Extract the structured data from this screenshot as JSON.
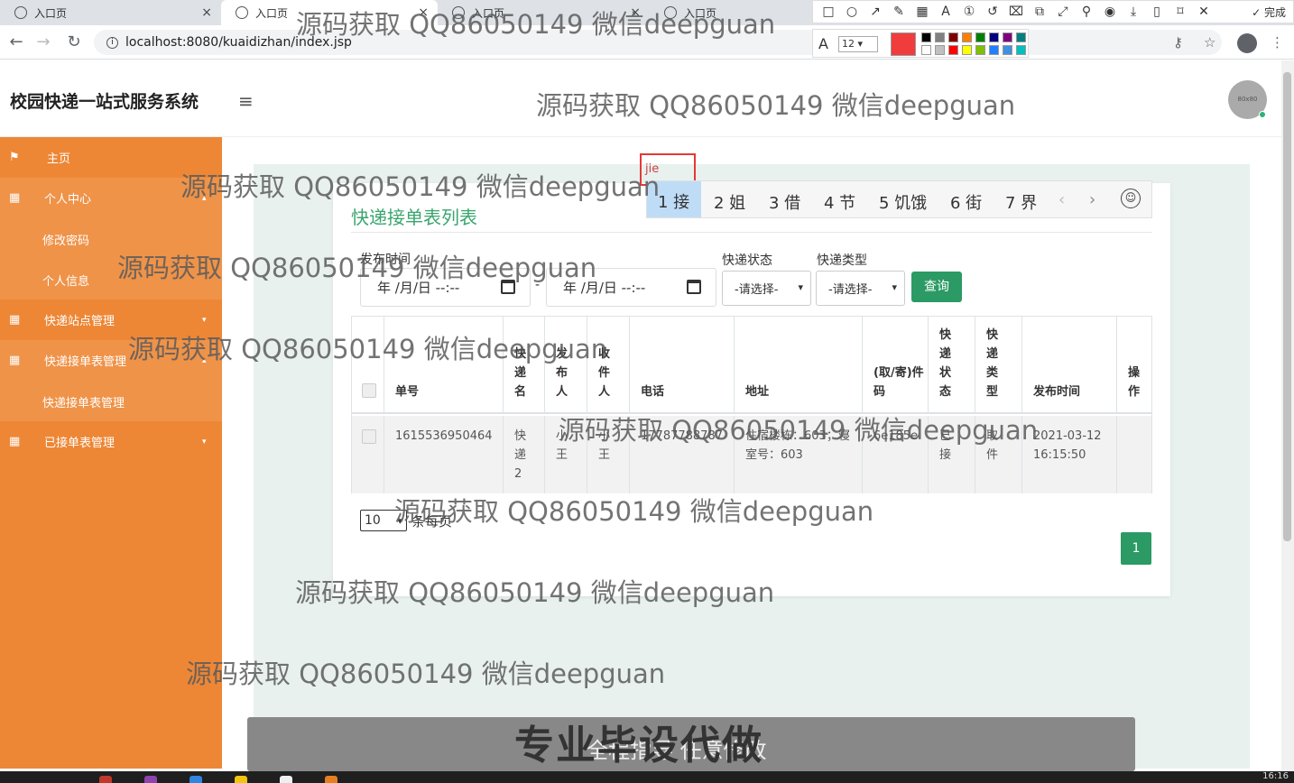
{
  "browser": {
    "tabs": [
      {
        "title": "入口页",
        "active": false
      },
      {
        "title": "入口页",
        "active": true
      },
      {
        "title": "入口页",
        "active": false
      },
      {
        "title": "入口页",
        "active": false
      }
    ],
    "url": "localhost:8080/kuaidizhan/index.jsp"
  },
  "annotation_toolbar": {
    "done_label": "完成",
    "font_size": "12",
    "current_color": "#f03c3c"
  },
  "app": {
    "title": "校园快递一站式服务系统",
    "avatar_text": "80x80"
  },
  "sidebar": {
    "items": [
      {
        "label": "主页"
      },
      {
        "label": "个人中心"
      },
      {
        "label": "修改密码"
      },
      {
        "label": "个人信息"
      },
      {
        "label": "快递站点管理"
      },
      {
        "label": "快递接单表管理"
      },
      {
        "label": "快递接单表管理"
      },
      {
        "label": "已接单表管理"
      }
    ]
  },
  "page": {
    "title": "快递接单表列表",
    "filters": {
      "publish_time_label": "发布时间",
      "date_placeholder": "年 /月/日  --:--",
      "status_label": "快递状态",
      "type_label": "快递类型",
      "select_placeholder": "-请选择-",
      "query_button": "查询"
    },
    "table": {
      "headers": [
        "单号",
        "快递名",
        "发布人",
        "收件人",
        "电话",
        "地址",
        "(取/寄)件码",
        "快递状态",
        "快递类型",
        "发布时间",
        "操作"
      ],
      "rows": [
        {
          "order_no": "1615536950464",
          "express_name": "快递2",
          "publisher": "小王",
          "receiver": "小王",
          "phone": "17787788787",
          "address": "住宿楼栋：603；寝室号：603",
          "code": "6e185e",
          "status": "已接",
          "type": "取件",
          "publish_time": "2021-03-12 16:15:50"
        }
      ]
    },
    "pagination": {
      "page_size": "10",
      "page_size_label": "条每页",
      "current_page": "1"
    }
  },
  "ime": {
    "input_text": "jie",
    "candidates": [
      "1 接",
      "2 姐",
      "3 借",
      "4 节",
      "5 饥饿",
      "6 街",
      "7 界"
    ]
  },
  "watermark": "源码获取 QQ86050149 微信deepguan",
  "banner": {
    "title": "专业毕设代做",
    "subtitle": "全程指导 任意修改"
  },
  "taskbar": {
    "time": "16:16"
  }
}
